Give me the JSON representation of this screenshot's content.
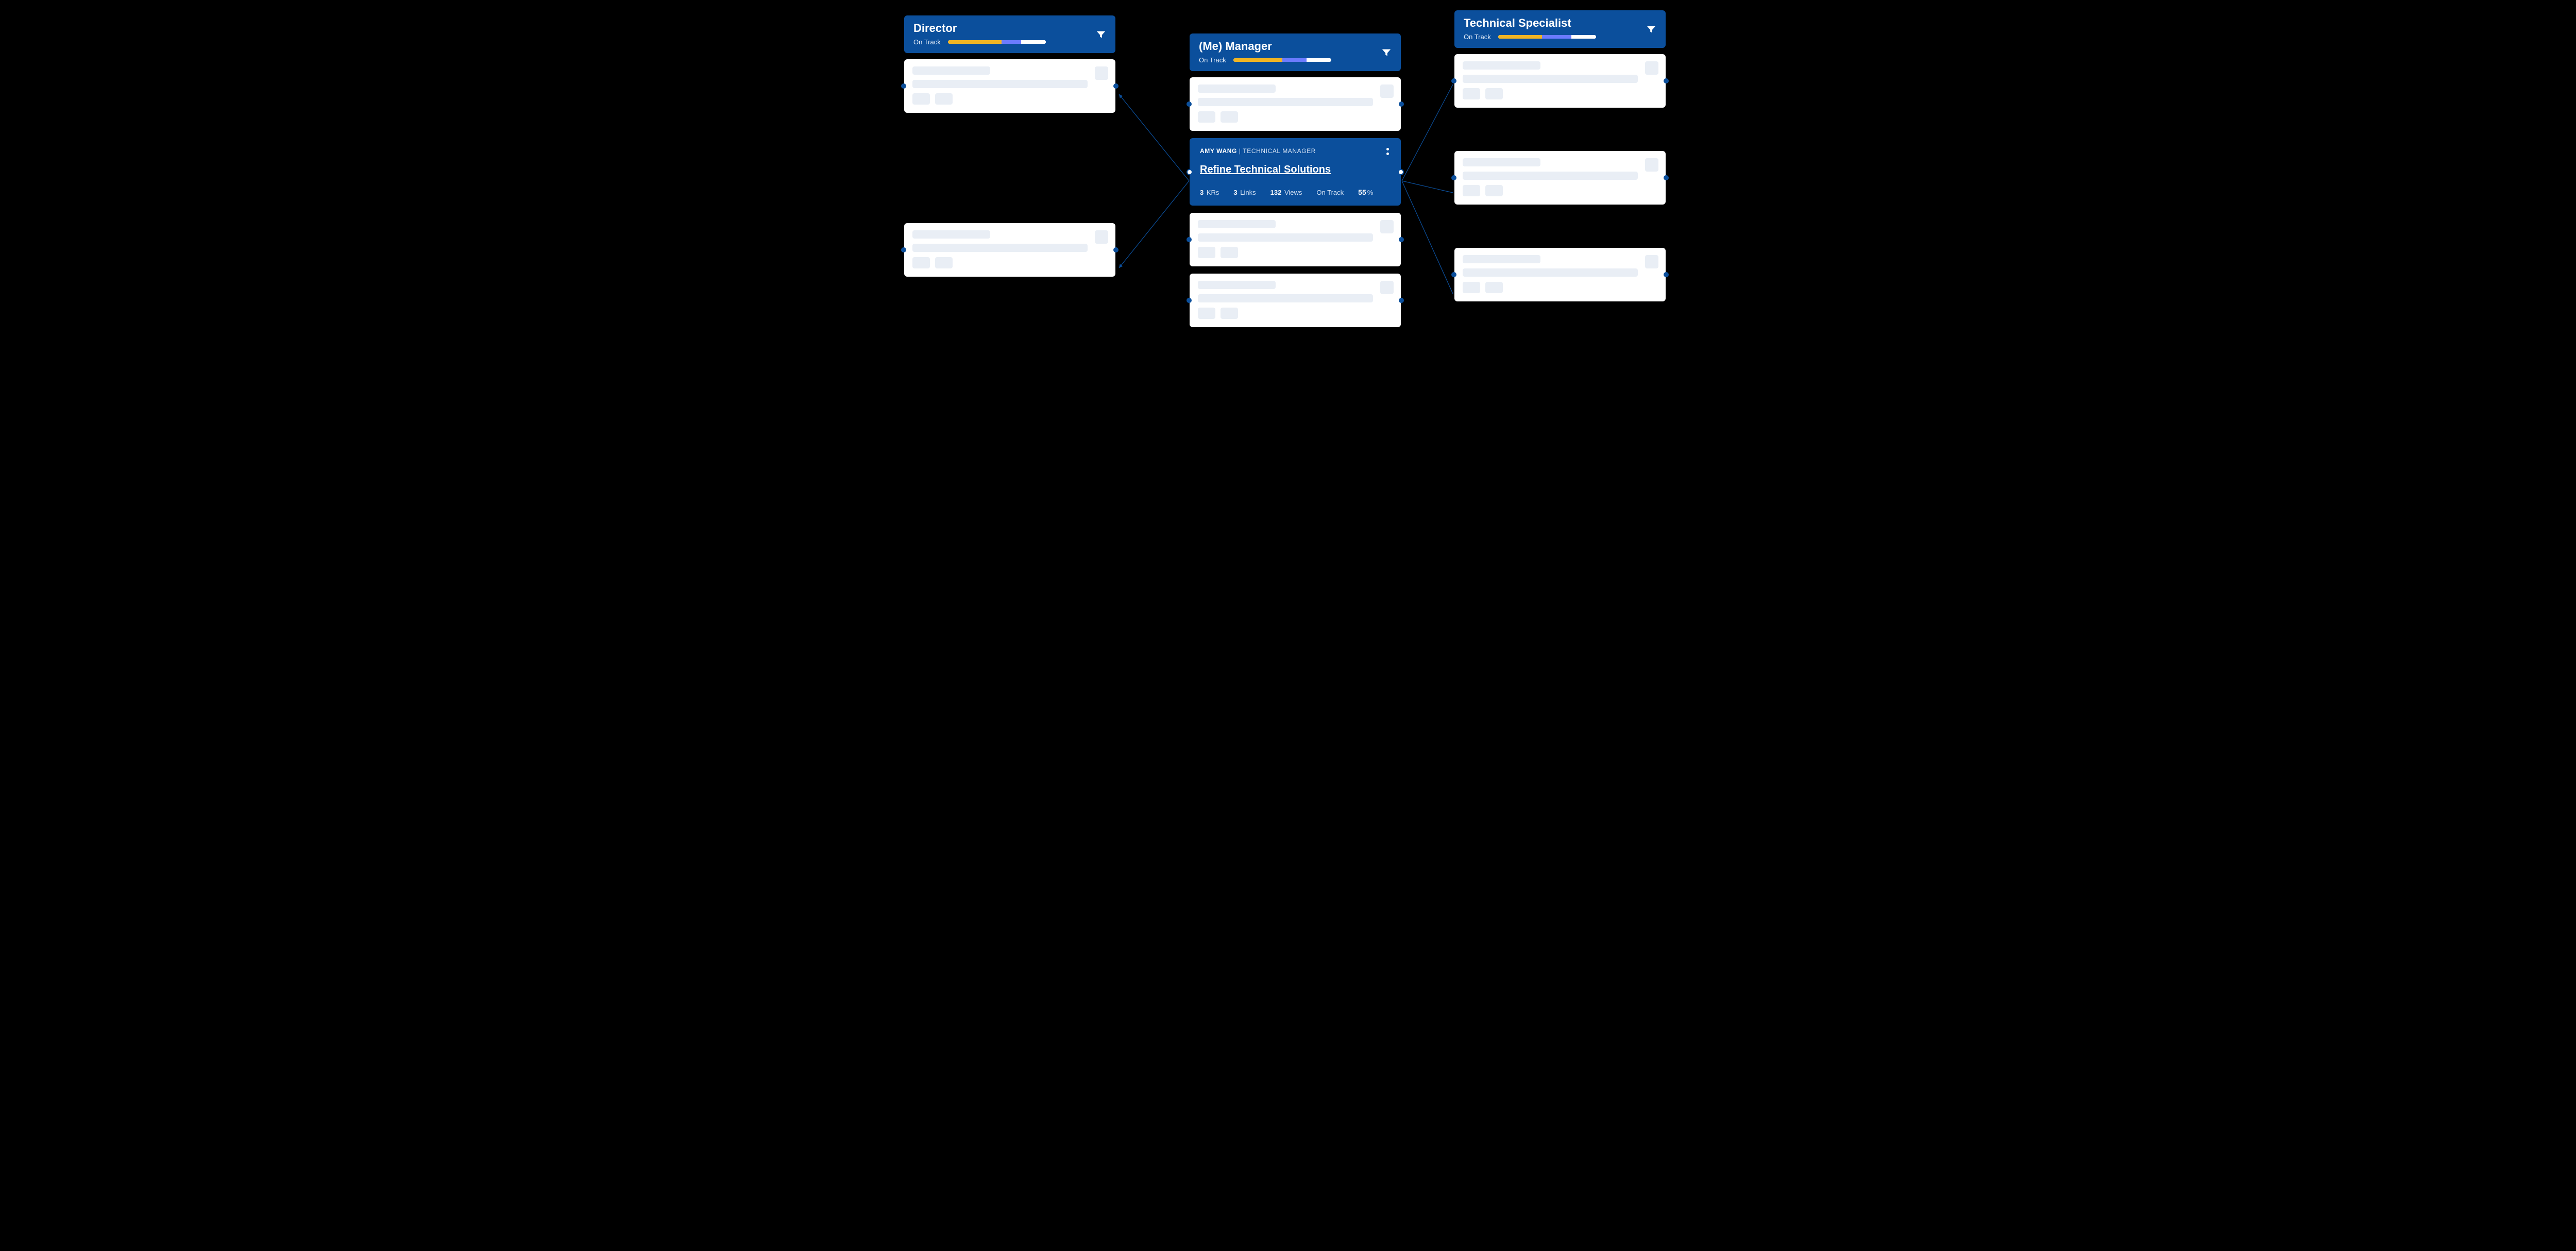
{
  "columns": {
    "left": {
      "title": "Director",
      "status": "On Track",
      "progress": {
        "yellowPct": 55,
        "bluePct": 20,
        "restPct": 25
      }
    },
    "mid": {
      "title": "(Me) Manager",
      "status": "On Track",
      "progress": {
        "yellowPct": 50,
        "bluePct": 25,
        "restPct": 25
      },
      "detail": {
        "ownerName": "AMY WANG",
        "ownerRole": "TECHNICAL MANAGER",
        "objective": "Refine Technical Solutions",
        "krs": {
          "count": "3",
          "label": "KRs"
        },
        "links": {
          "count": "3",
          "label": "Links"
        },
        "views": {
          "count": "132",
          "label": "Views"
        },
        "status": "On Track",
        "percent": "55",
        "percentSuffix": "%"
      }
    },
    "right": {
      "title": "Technical Specialist",
      "status": "On Track",
      "progress": {
        "yellowPct": 45,
        "bluePct": 30,
        "restPct": 25
      }
    }
  }
}
